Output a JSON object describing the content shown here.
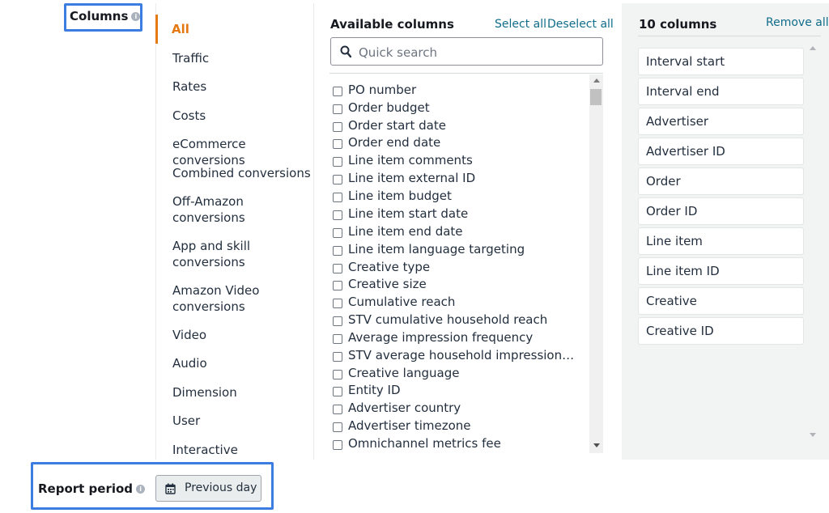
{
  "columns_section": {
    "label": "Columns",
    "info": "i"
  },
  "categories": [
    {
      "label": "All",
      "active": true
    },
    {
      "label": "Traffic"
    },
    {
      "label": "Rates"
    },
    {
      "label": "Costs"
    },
    {
      "label": "eCommerce conversions"
    },
    {
      "label": "Combined conversions"
    },
    {
      "label": "Off-Amazon conversions",
      "line1": "Off-Amazon",
      "line2": "conversions"
    },
    {
      "label": "App and skill conversions",
      "line1": "App and skill",
      "line2": "conversions"
    },
    {
      "label": "Amazon Video conversions",
      "line1": "Amazon Video",
      "line2": "conversions"
    },
    {
      "label": "Video"
    },
    {
      "label": "Audio"
    },
    {
      "label": "Dimension"
    },
    {
      "label": "User"
    },
    {
      "label": "Interactive"
    }
  ],
  "available": {
    "title": "Available columns",
    "select_all": "Select all",
    "deselect_all": "Deselect all",
    "search_placeholder": "Quick search",
    "items": [
      "PO number",
      "Order budget",
      "Order start date",
      "Order end date",
      "Line item comments",
      "Line item external ID",
      "Line item budget",
      "Line item start date",
      "Line item end date",
      "Line item language targeting",
      "Creative type",
      "Creative size",
      "Cumulative reach",
      "STV cumulative household reach",
      "Average impression frequency",
      "STV average household impression…",
      "Creative language",
      "Entity ID",
      "Advertiser country",
      "Advertiser timezone",
      "Omnichannel metrics fee"
    ]
  },
  "selected": {
    "title": "10 columns",
    "remove_all": "Remove all",
    "items": [
      "Interval start",
      "Interval end",
      "Advertiser",
      "Advertiser ID",
      "Order",
      "Order ID",
      "Line item",
      "Line item ID",
      "Creative",
      "Creative ID"
    ]
  },
  "report_period": {
    "label": "Report period",
    "info": "i",
    "button": "Previous day"
  },
  "colors": {
    "accent_orange": "#e47911",
    "link": "#0f6d8a",
    "highlight": "#3b7de0"
  }
}
